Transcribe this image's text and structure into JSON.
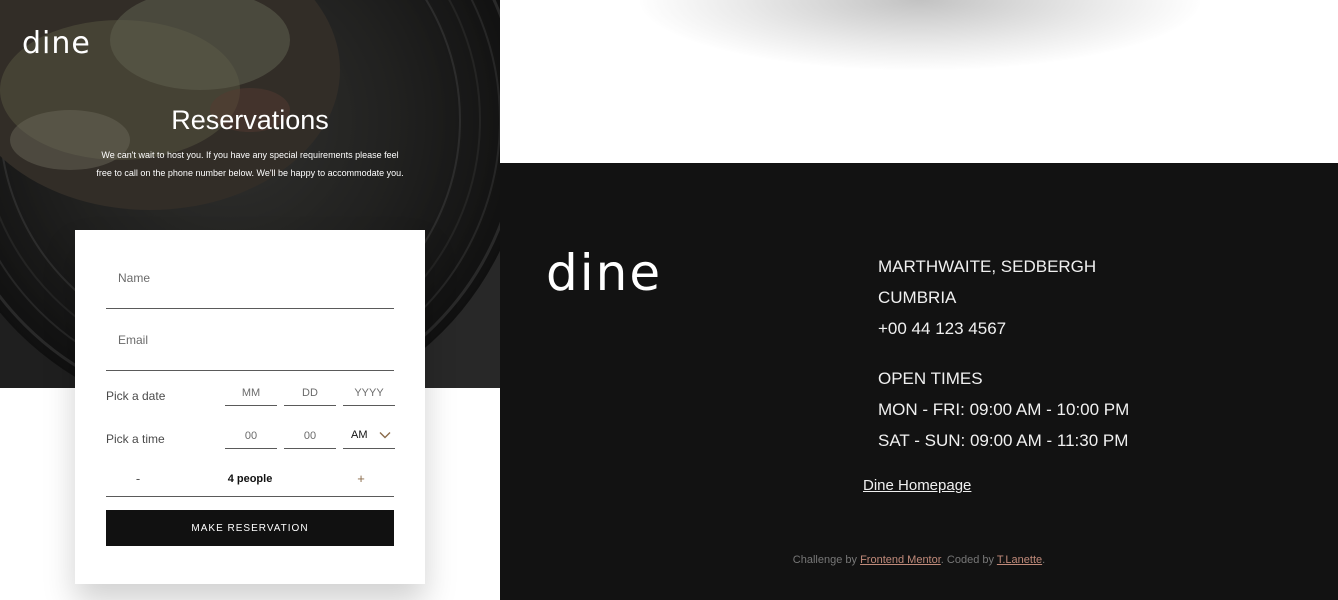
{
  "hero": {
    "logo": "dine",
    "title": "Reservations",
    "description": "We can't wait to host you. If you have any special requirements please feel free to call on the phone number below. We'll be happy to accommodate you."
  },
  "form": {
    "name_placeholder": "Name",
    "email_placeholder": "Email",
    "date_label": "Pick a date",
    "date_mm_placeholder": "MM",
    "date_dd_placeholder": "DD",
    "date_yyyy_placeholder": "YYYY",
    "time_label": "Pick a time",
    "time_hour_placeholder": "00",
    "time_minute_placeholder": "00",
    "ampm_value": "AM",
    "ampm_icon": "chevron-down-icon",
    "minus_label": "-",
    "people_count": "4 people",
    "plus_label": "+",
    "submit_label": "MAKE RESERVATION"
  },
  "footer": {
    "logo": "dine",
    "address": {
      "line1": "MARTHWAITE, SEDBERGH",
      "line2": "CUMBRIA",
      "phone": "+00 44 123 4567"
    },
    "times": {
      "heading": "OPEN TIMES",
      "weekdays": "MON - FRI: 09:00 AM - 10:00 PM",
      "weekend": "SAT - SUN: 09:00 AM - 11:30 PM"
    },
    "home_link": "Dine Homepage",
    "attribution": {
      "prefix": "Challenge by ",
      "link1": "Frontend Mentor",
      "middle": ". Coded by ",
      "link2": "T.Lanette",
      "suffix": "."
    }
  },
  "colors": {
    "footer_bg": "#121212",
    "button_bg": "#111111",
    "accent_link": "#c08a7a",
    "plus_accent": "#8a6a4a"
  }
}
